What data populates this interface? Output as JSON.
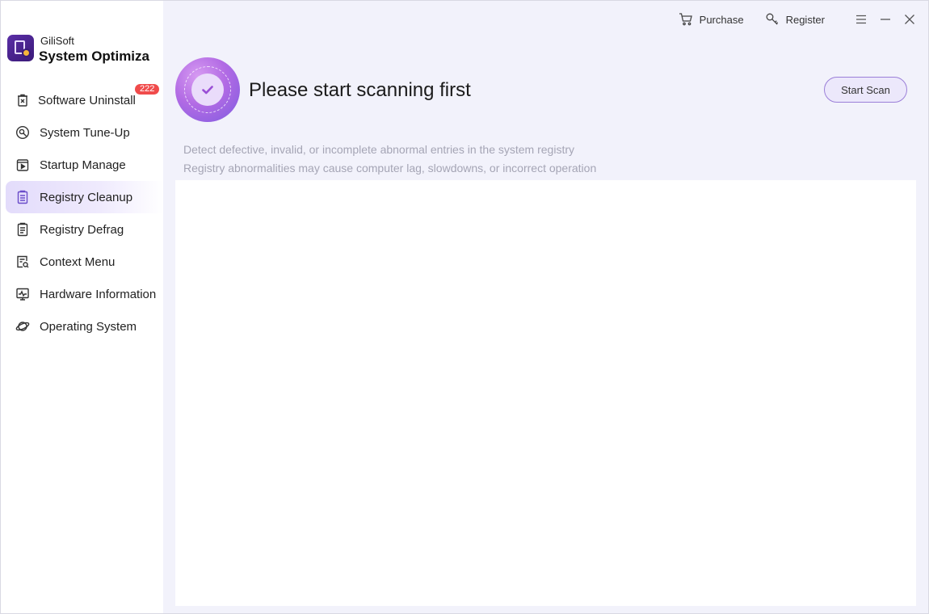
{
  "app": {
    "brand_small": "GiliSoft",
    "brand_name": "System Optimiza",
    "logo_icon": "app-logo-icon"
  },
  "topbar": {
    "purchase_label": "Purchase",
    "register_label": "Register",
    "purchase_icon": "cart-icon",
    "register_icon": "key-icon",
    "menu_icon": "menu-icon",
    "minimize_icon": "minimize-icon",
    "close_icon": "close-icon"
  },
  "sidebar": {
    "items": [
      {
        "label": "Software Uninstall",
        "icon": "uninstall-icon",
        "badge": "222",
        "active": false
      },
      {
        "label": "System Tune-Up",
        "icon": "tune-up-icon",
        "active": false
      },
      {
        "label": "Startup Manage",
        "icon": "startup-icon",
        "active": false
      },
      {
        "label": "Registry Cleanup",
        "icon": "registry-cleanup-icon",
        "active": true
      },
      {
        "label": "Registry Defrag",
        "icon": "registry-defrag-icon",
        "active": false
      },
      {
        "label": "Context Menu",
        "icon": "context-menu-icon",
        "active": false
      },
      {
        "label": "Hardware Information",
        "icon": "hardware-icon",
        "active": false
      },
      {
        "label": "Operating System",
        "icon": "os-planet-icon",
        "active": false
      }
    ]
  },
  "main": {
    "status_title": "Please start scanning first",
    "status_icon": "check-icon",
    "start_scan_label": "Start Scan",
    "desc_line1": "Detect defective, invalid, or incomplete abnormal entries in the system registry",
    "desc_line2": "Registry abnormalities may cause computer lag, slowdowns, or incorrect operation"
  },
  "colors": {
    "accent": "#8f6ee0",
    "badge": "#f04b4b",
    "main_bg": "#f2f2fb",
    "active_item_bg": "#e3dcfb"
  }
}
